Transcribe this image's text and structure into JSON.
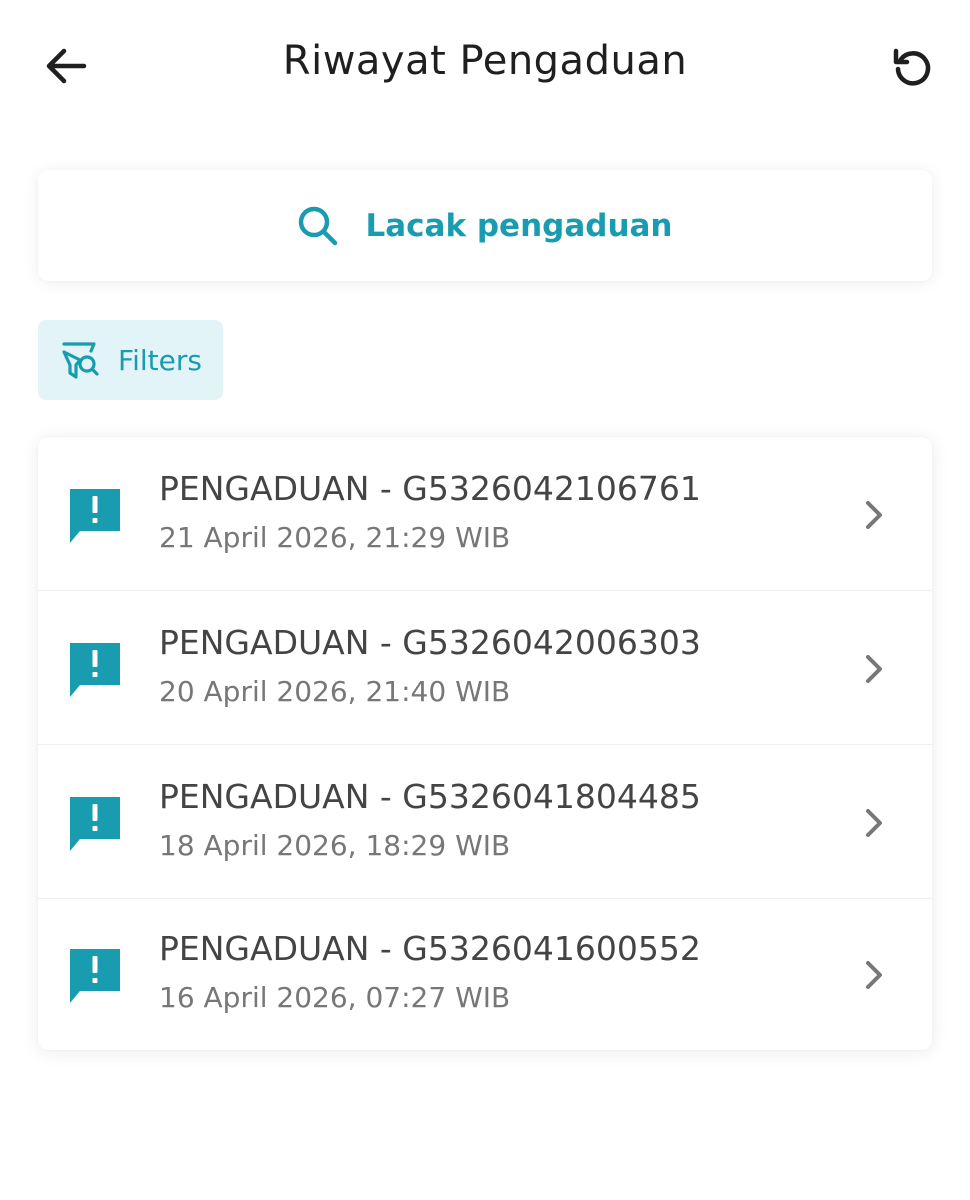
{
  "header": {
    "title": "Riwayat Pengaduan",
    "back_icon": "arrow-left-icon",
    "refresh_icon": "refresh-icon"
  },
  "track": {
    "label": "Lacak pengaduan",
    "icon": "search-icon"
  },
  "filters": {
    "label": "Filters",
    "icon": "filter-search-icon"
  },
  "complaints": [
    {
      "title": "PENGADUAN - G5326042106761",
      "date": "21 April 2026, 21:29 WIB",
      "icon": "alert-message-icon"
    },
    {
      "title": "PENGADUAN - G5326042006303",
      "date": "20 April 2026, 21:40 WIB",
      "icon": "alert-message-icon"
    },
    {
      "title": "PENGADUAN - G5326041804485",
      "date": "18 April 2026, 18:29 WIB",
      "icon": "alert-message-icon"
    },
    {
      "title": "PENGADUAN - G5326041600552",
      "date": "16 April 2026, 07:27 WIB",
      "icon": "alert-message-icon"
    }
  ],
  "colors": {
    "accent": "#1a9cb0",
    "filter_bg": "#e3f4f8",
    "title_text": "#444444",
    "date_text": "#777777",
    "chevron": "#777777"
  }
}
